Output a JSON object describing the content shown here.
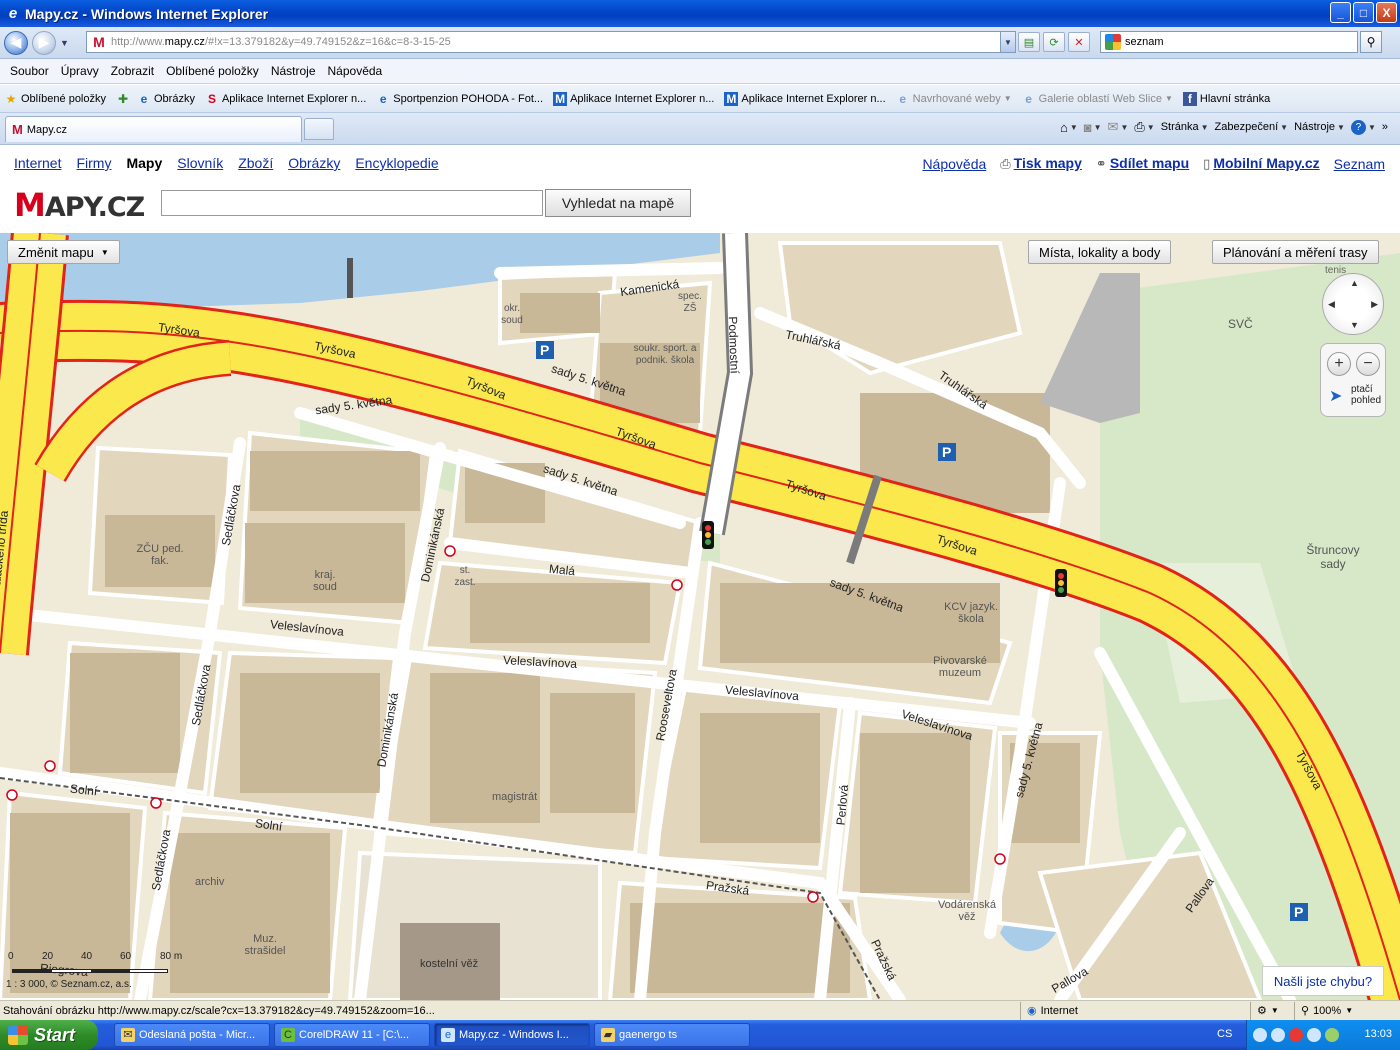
{
  "window": {
    "title": "Mapy.cz - Windows Internet Explorer",
    "min_label": "_",
    "max_label": "□",
    "close_label": "X"
  },
  "address": {
    "url_prefix": "http://www.",
    "url_domain": "mapy.cz",
    "url_rest": "/#!x=13.379182&y=49.749152&z=16&c=8-3-15-25",
    "search_value": "seznam"
  },
  "menu": [
    "Soubor",
    "Úpravy",
    "Zobrazit",
    "Oblíbené položky",
    "Nástroje",
    "Nápověda"
  ],
  "favorites": {
    "label": "Oblíbené položky",
    "items": [
      {
        "label": "Obrázky",
        "icon": "e",
        "grey": false
      },
      {
        "label": "Aplikace Internet Explorer n...",
        "icon": "S",
        "grey": false
      },
      {
        "label": "Sportpenzion POHODA - Fot...",
        "icon": "e",
        "grey": false
      },
      {
        "label": "Aplikace Internet Explorer n...",
        "icon": "M",
        "grey": false
      },
      {
        "label": "Aplikace Internet Explorer n...",
        "icon": "M",
        "grey": false
      },
      {
        "label": "Navrhované weby",
        "icon": "e",
        "grey": true
      },
      {
        "label": "Galerie oblastí Web Slice",
        "icon": "e",
        "grey": true
      },
      {
        "label": "Hlavní stránka",
        "icon": "f",
        "grey": false
      }
    ]
  },
  "tab": {
    "label": "Mapy.cz"
  },
  "commandbar": {
    "page": "Stránka",
    "safety": "Zabezpečení",
    "tools": "Nástroje"
  },
  "site": {
    "nav": [
      "Internet",
      "Firmy",
      "Mapy",
      "Slovník",
      "Zboží",
      "Obrázky",
      "Encyklopedie"
    ],
    "active_nav": "Mapy",
    "right_links": {
      "help": "Nápověda",
      "print": "Tisk mapy",
      "share": "Sdílet mapu",
      "mobile": "Mobilní Mapy.cz",
      "seznam": "Seznam"
    },
    "logo_m": "M",
    "logo_rest": "APY.CZ",
    "search_placeholder": "",
    "search_button": "Vyhledat na mapě"
  },
  "map": {
    "change_map": "Změnit mapu",
    "places_btn": "Místa, lokality a body",
    "planning_btn": "Plánování a měření trasy",
    "tennis": "tenis",
    "bird_view": "ptačí pohled",
    "scale_ticks": [
      "0",
      "20",
      "40",
      "60",
      "80 m"
    ],
    "scale_text": "1 : 3 000, © Seznam.cz, a.s.",
    "error_btn": "Našli jste chybu?",
    "labels": [
      {
        "t": "Tyršova"
      },
      {
        "t": "Tyršova"
      },
      {
        "t": "Tyršova"
      },
      {
        "t": "Tyršova"
      },
      {
        "t": "Tyršova"
      },
      {
        "t": "Tyršova"
      },
      {
        "t": "Tyršova"
      },
      {
        "t": "sady 5. května"
      },
      {
        "t": "sady 5. května"
      },
      {
        "t": "sady 5. května"
      },
      {
        "t": "sady 5. května"
      },
      {
        "t": "sady 5. května"
      },
      {
        "t": "Kamenická"
      },
      {
        "t": "Podmostní"
      },
      {
        "t": "Truhlářská"
      },
      {
        "t": "Truhlářská"
      },
      {
        "t": "Veleslavínova"
      },
      {
        "t": "Veleslavínova"
      },
      {
        "t": "Veleslavínova"
      },
      {
        "t": "Veleslavínova"
      },
      {
        "t": "Sedláčkova"
      },
      {
        "t": "Sedláčkova"
      },
      {
        "t": "Sedláčkova"
      },
      {
        "t": "Dominikánská"
      },
      {
        "t": "Dominikánská"
      },
      {
        "t": "Rooseveltova"
      },
      {
        "t": "Malá"
      },
      {
        "t": "Solní"
      },
      {
        "t": "Solní"
      },
      {
        "t": "Pražská"
      },
      {
        "t": "Pražská"
      },
      {
        "t": "Perlová"
      },
      {
        "t": "Pallova"
      },
      {
        "t": "Pallova"
      },
      {
        "t": "Riegrova"
      },
      {
        "t": "Palackého třída"
      },
      {
        "t": "okr. soud"
      },
      {
        "t": "spec. ZŠ"
      },
      {
        "t": "soukr. sport. a podnik. škola"
      },
      {
        "t": "ZČU ped. fak."
      },
      {
        "t": "kraj. soud"
      },
      {
        "t": "st. zast."
      },
      {
        "t": "magistrát"
      },
      {
        "t": "archiv"
      },
      {
        "t": "Muz. strašidel"
      },
      {
        "t": "kostelní věž"
      },
      {
        "t": "KCV jazyk. škola"
      },
      {
        "t": "Pivovarské muzeum"
      },
      {
        "t": "Vodárenská věž"
      },
      {
        "t": "Štruncovy sady"
      },
      {
        "t": "SVČ"
      }
    ]
  },
  "status": {
    "text": "Stahování obrázku http://www.mapy.cz/scale?cx=13.379182&cy=49.749152&zoom=16...",
    "zone": "Internet",
    "zoom": "100%"
  },
  "taskbar": {
    "start": "Start",
    "items": [
      {
        "label": "Odeslaná pošta - Micr...",
        "active": false
      },
      {
        "label": "CorelDRAW 11 - [C:\\...",
        "active": false
      },
      {
        "label": "Mapy.cz - Windows I...",
        "active": true
      },
      {
        "label": "gaenergo ts",
        "active": false
      }
    ],
    "lang": "CS",
    "clock": "13:03"
  },
  "colors": {
    "map_bg": "#f0ead8",
    "block": "#e2d6bd",
    "building": "#c9b898",
    "road_main": "#fbe84d",
    "road_edge": "#e2231a",
    "water": "#a9cce8",
    "park": "#d7e8c8",
    "link": "#0d2fa8"
  }
}
